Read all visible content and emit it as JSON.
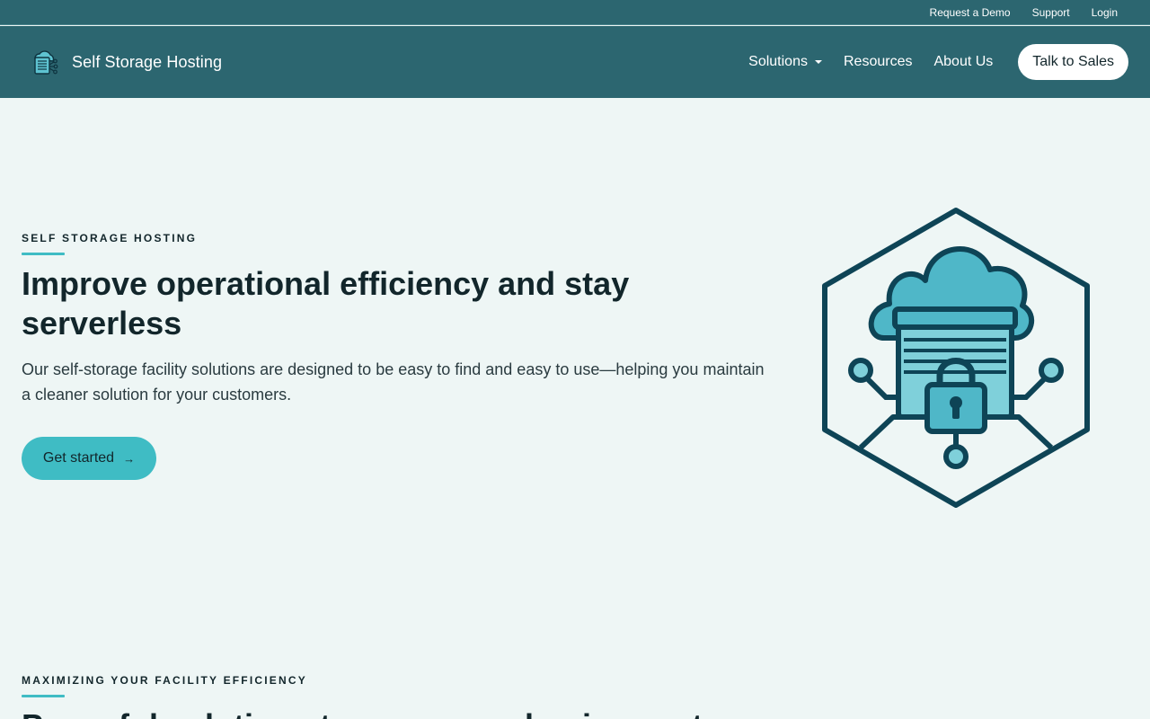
{
  "utility_nav": {
    "request_demo": "Request a Demo",
    "support": "Support",
    "login": "Login"
  },
  "header": {
    "brand_name": "Self Storage Hosting",
    "logo_icon": "cloud-storage-icon",
    "nav": {
      "solutions": "Solutions",
      "resources": "Resources",
      "about": "About Us"
    },
    "cta": "Talk to Sales"
  },
  "hero": {
    "eyebrow": "SELF STORAGE HOSTING",
    "title": "Improve operational efficiency and stay serverless",
    "description": "Our self-storage facility solutions are designed to be easy to find and easy to use—helping you maintain a cleaner solution for your customers.",
    "cta_label": "Get started",
    "cta_icon": "arrow-right-icon",
    "illustration_icon": "secure-cloud-storage-icon"
  },
  "section_two": {
    "eyebrow": "MAXIMIZING YOUR FACILITY EFFICIENCY",
    "title": "Powerful solutions to grow your business at"
  },
  "colors": {
    "header_bg": "#2c6670",
    "page_bg": "#eef6f5",
    "accent": "#3fbcc4",
    "illustration_stroke": "#0e4456",
    "illustration_fill": "#4fb7c8",
    "text_dark": "#12262b"
  }
}
